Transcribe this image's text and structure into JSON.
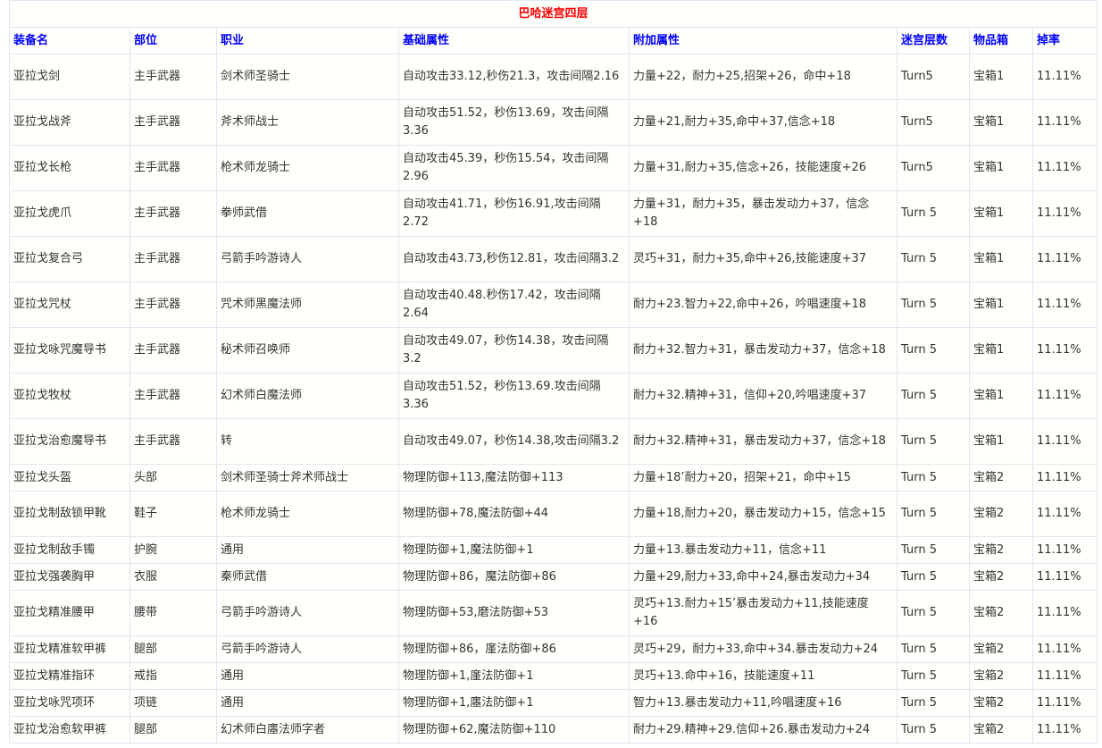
{
  "title": "巴哈迷宫四层",
  "headers": [
    "装备名",
    "部位",
    "职业",
    "基础属性",
    "附加属性",
    "迷宫层数",
    "物品箱",
    "掉率"
  ],
  "rows": [
    [
      "亚拉戈剑",
      "主手武器",
      "剑术师圣骑士",
      "自动攻击33.12,秒伤21.3，攻击间隔2.16",
      "力量+22，耐力+25,招架+26，命中+18",
      "Turn5",
      "宝箱1",
      "11.11%"
    ],
    [
      "亚拉戈战斧",
      "主手武器",
      "斧术师战士",
      "自动攻击51.52，秒伤13.69，攻击间隔3.36",
      "力量+21,耐力+35,命中+37,信念+18",
      "Turn5",
      "宝箱1",
      "11.11%"
    ],
    [
      "亚拉戈长枪",
      "主手武器",
      "枪术师龙骑士",
      "自动攻击45.39，秒伤15.54，攻击间隔2.96",
      "力量+31,耐力+35,信念+26，技能速度+26",
      "Turn5",
      "宝箱1",
      "11.11%"
    ],
    [
      "亚拉戈虎爪",
      "主手武器",
      "拳师武借",
      "自动攻击41.71，秒伤16.91,攻击间隔2.72",
      "力量+31，耐力+35，暴击发动力+37，信念+18",
      "Turn 5",
      "宝箱1",
      "11.11%"
    ],
    [
      "亚拉戈复合弓",
      "主手武器",
      "弓箭手吟游诗人",
      "自动攻击43.73,秒伤12.81，攻击间隔3.2",
      "灵巧+31，耐力+35,命中+26,技能速度+37",
      "Turn 5",
      "宝箱1",
      "11.11%"
    ],
    [
      "亚拉戈咒杖",
      "主手武器",
      "咒术师黑魔法师",
      "自动攻击40.48.秒伤17.42，攻击间隔2.64",
      "耐力+23.智力+22,命中+26，吟唱速度+18",
      "Turn 5",
      "宝箱1",
      "11.11%"
    ],
    [
      "亚拉戈咏咒魔导书",
      "主手武器",
      "秘术师召唤师",
      "自动攻击49.07，秒伤14.38，攻击间隔3.2",
      "耐力+32.智力+31，暴击发动力+37，信念+18",
      "Turn 5",
      "宝箱1",
      "11.11%"
    ],
    [
      "亚拉戈牧杖",
      "主手武器",
      "幻术师白魔法师",
      "自动攻击51.52，秒伤13.69.攻击间隔3.36",
      "耐力+32.精神+31，信仰+20,吟唱速度+37",
      "Turn 5",
      "宝箱1",
      "11.11%"
    ],
    [
      "亚拉戈治愈魔导书",
      "主手武器",
      "转",
      "自动攻击49.07，秒伤14.38,攻击间隔3.2",
      "耐力+32.精神+31，暴击发动力+37，信念+18",
      "Turn 5",
      "宝箱1",
      "11.11%"
    ],
    [
      "亚拉戈头盔",
      "头部",
      "剑术师圣骑士斧术师战士",
      "物理防御+113,魔法防御+113",
      "力量+18’耐力+20，招架+21，命中+15",
      "Turn 5",
      "宝箱2",
      "11.11%"
    ],
    [
      "亚拉戈制敌锁甲靴",
      "鞋子",
      "枪术师龙骑士",
      "物理防御+78,魔法防御+44",
      "力量+18,耐力+20，暴击发动力+15，信念+15",
      "Turn 5",
      "宝箱2",
      "11.11%"
    ],
    [
      "亚拉戈制敌手镯",
      "护腕",
      "通用",
      "物理防御+1,魔法防御+1",
      "力量+13.暴击发动力+11，信念+11",
      "Turn 5",
      "宝箱2",
      "11.11%"
    ],
    [
      "亚拉戈强袭胸甲",
      "衣服",
      "秦师武借",
      "物理防御+86，魔法防御+86",
      "力量+29,耐力+33,命中+24,暴击发动力+34",
      "Turn 5",
      "宝箱2",
      "11.11%"
    ],
    [
      "亚拉戈精准腰甲",
      "腰带",
      "弓箭手吟游诗人",
      "物理防御+53,磨法防御+53",
      "灵巧+13.耐力+15’暴击发动力+11,技能速度+16",
      "Turn 5",
      "宝箱2",
      "11.11%"
    ],
    [
      "亚拉戈精准软甲裤",
      "腿部",
      "弓箭手吟游诗人",
      "物理防御+86，廑法防御+86",
      "灵巧+29，耐力+33,命中+34.暴击发动力+24",
      "Turn 5",
      "宝箱2",
      "11.11%"
    ],
    [
      "亚拉戈精准指环",
      "戒指",
      "通用",
      "物理防御+1,廑法防御+1",
      "灵巧+13.命中+16，技能速度+11",
      "Turn 5",
      "宝箱2",
      "11.11%"
    ],
    [
      "亚拉戈咏咒项环",
      "项链",
      "通用",
      "物理防御+1,廛法防御+1",
      "智力+13.暴击发动力+11,吟唱速度+16",
      "Turn 5",
      "宝箱2",
      "11.11%"
    ],
    [
      "亚拉戈治愈软甲裤",
      "腿部",
      "幻术师白廛法师字者",
      "物理防御+62,魔法防御+110",
      "耐力+29.精神+29.信仰+26.暴击发动力+24",
      "Turn 5",
      "宝箱2",
      "11.11%"
    ]
  ]
}
